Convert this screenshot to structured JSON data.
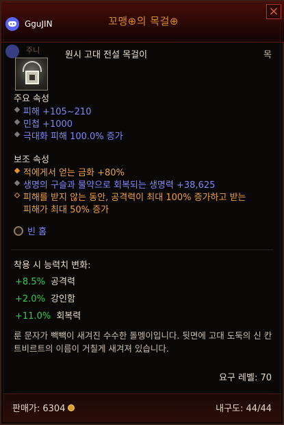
{
  "header": {
    "title": "꼬맹⊕의 목걸⊕",
    "close_icon": "close-icon"
  },
  "overlay": {
    "username": "GguJIN",
    "faded_label": "주니"
  },
  "item": {
    "type": "원시 고대 전설 목걸이",
    "slot": "목",
    "icon": "necklace-icon"
  },
  "primary": {
    "title": "주요 속성",
    "stats": [
      "피해 +105~210",
      "민첩 +1000",
      "극대화 피해 100.0% 증가"
    ]
  },
  "secondary": {
    "title": "보조 속성",
    "stats": [
      "적에게서 얻는 금화 +80%",
      "생명의 구슬과 물약으로 회복되는 생명력 +38,625",
      "피해를 받지 않는 동안, 공격력이 최대 100% 증가하고 받는",
      "피해가 최대 50% 증가"
    ]
  },
  "socket": {
    "label": "빈 홈"
  },
  "changes": {
    "title": "착용 시 능력치 변화:",
    "items": [
      {
        "delta": "+8.5%",
        "label": "공격력"
      },
      {
        "delta": "+2.0%",
        "label": "강인함"
      },
      {
        "delta": "+11.0%",
        "label": "회복력"
      }
    ]
  },
  "flavor": "룬 문자가 빽빽이 새겨진 수수한 돌멩이입니다. 뒷면에 고대 도둑의 신 칸트비르트의 이름이 거칠게 새겨져 있습니다.",
  "requirement": "요구 레벨: 70",
  "footer": {
    "sell_price_label": "판매가: 6304",
    "durability": "내구도: 44/44"
  },
  "colors": {
    "title": "#d88a2a",
    "magic": "#7d87ff",
    "legendary_affix": "#f0a040",
    "positive": "#2fd04a"
  }
}
